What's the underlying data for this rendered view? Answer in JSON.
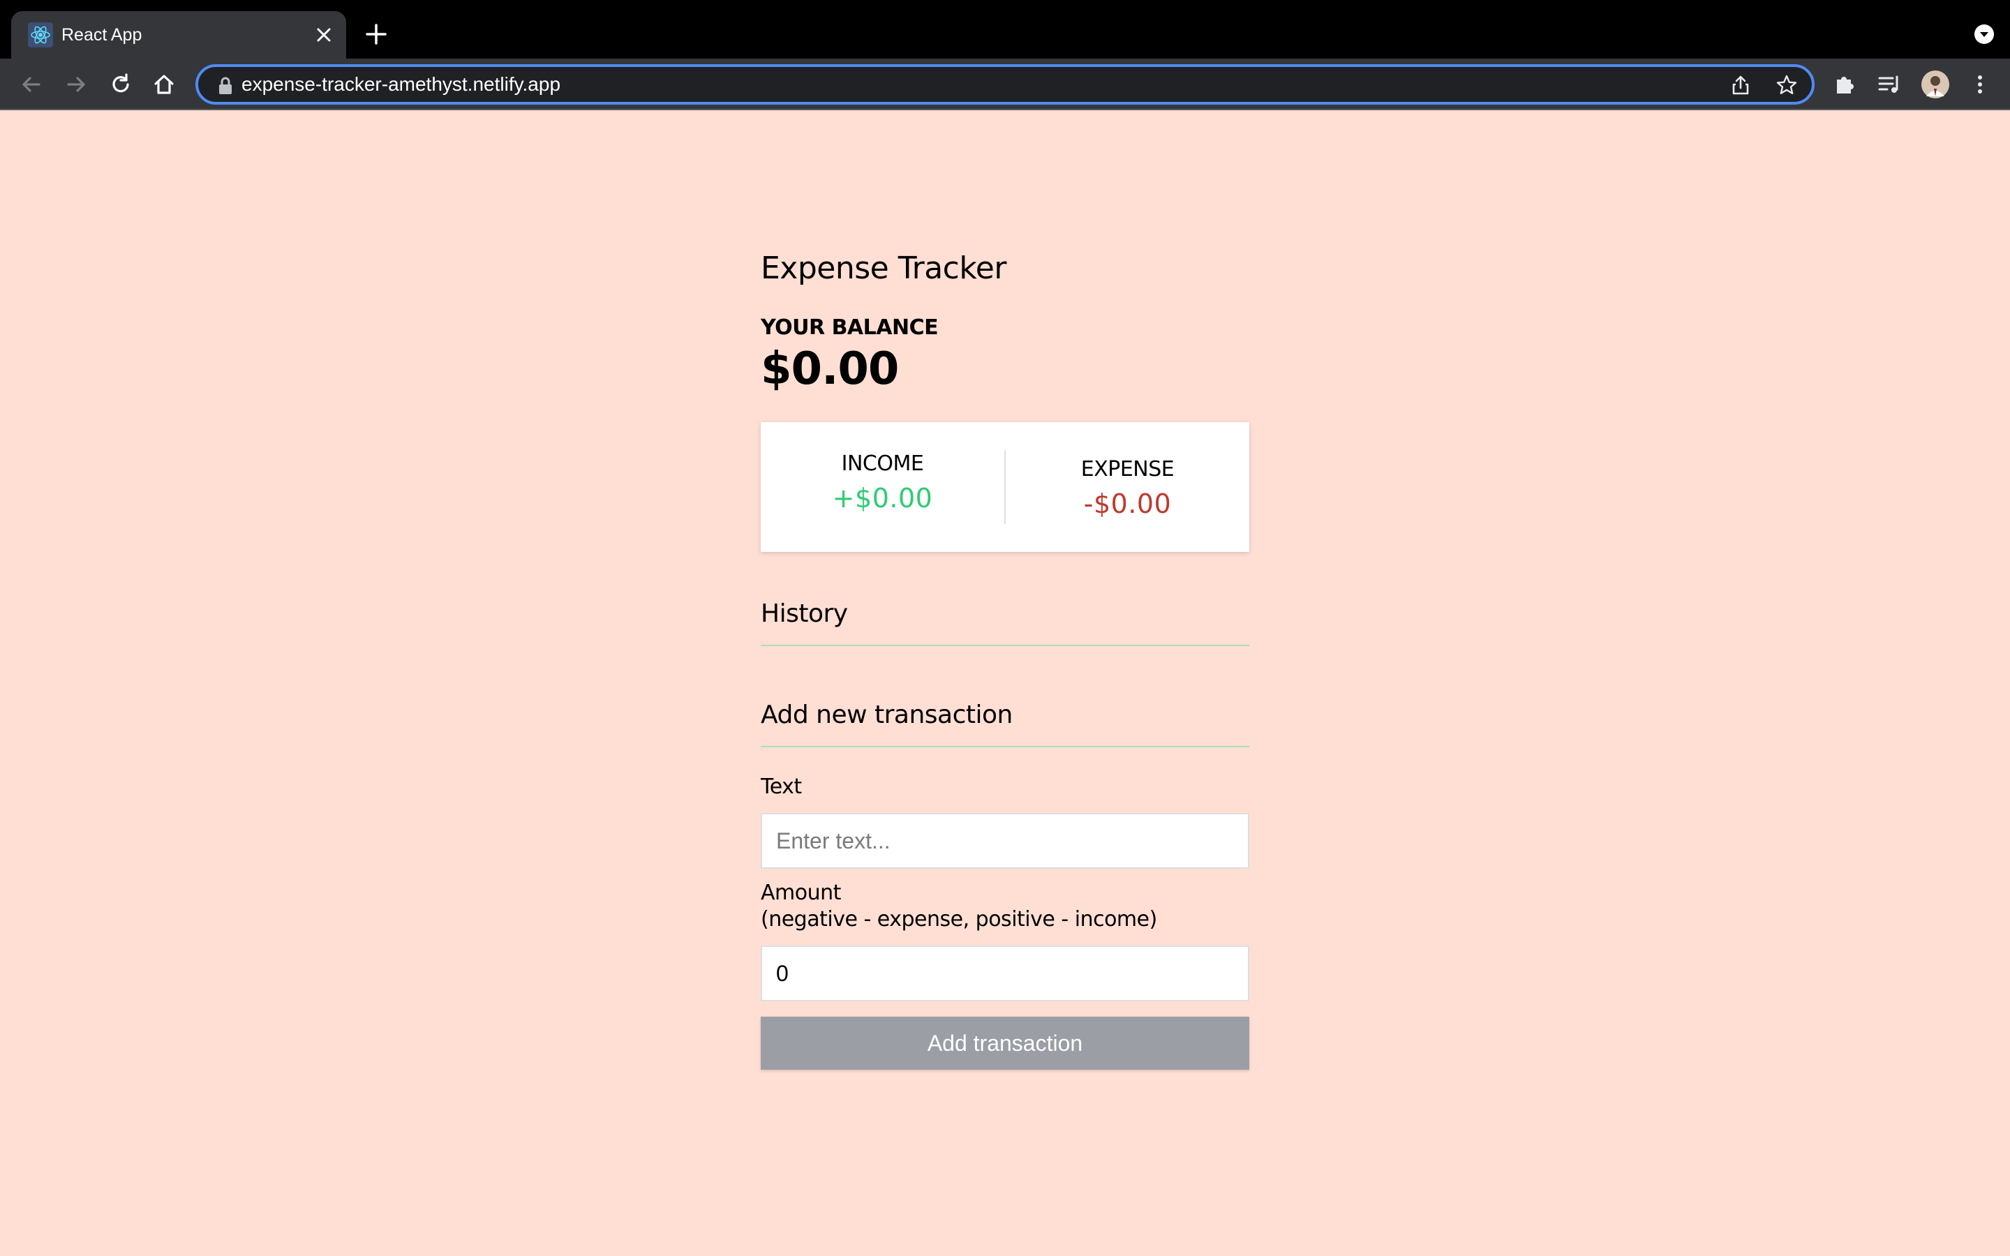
{
  "browser": {
    "tab_title": "React App",
    "url": "expense-tracker-amethyst.netlify.app",
    "accent_color": "#4f8bf5"
  },
  "app": {
    "title": "Expense Tracker",
    "balance_label": "YOUR BALANCE",
    "balance_value": "$0.00",
    "income_label": "INCOME",
    "income_value": "+$0.00",
    "expense_label": "EXPENSE",
    "expense_value": "-$0.00",
    "history_heading": "History",
    "add_heading": "Add new transaction",
    "text_label": "Text",
    "text_placeholder": "Enter text...",
    "amount_label": "Amount",
    "amount_hint": "(negative - expense, positive - income)",
    "amount_value": "0",
    "submit_label": "Add transaction",
    "colors": {
      "background": "#ffdfd4",
      "income": "#2ecc71",
      "expense": "#c0392b",
      "button": "#9c9ea5"
    }
  },
  "icons": {
    "favicon": "react-icon",
    "tab_close": "close-icon",
    "new_tab": "plus-icon",
    "back": "back-arrow-icon",
    "forward": "forward-arrow-icon",
    "reload": "reload-icon",
    "home": "home-icon",
    "lock": "lock-icon",
    "share": "share-icon",
    "bookmark": "star-icon",
    "extensions": "puzzle-icon",
    "reading_list": "reading-list-icon",
    "profile": "avatar",
    "menu": "kebab-menu-icon"
  }
}
